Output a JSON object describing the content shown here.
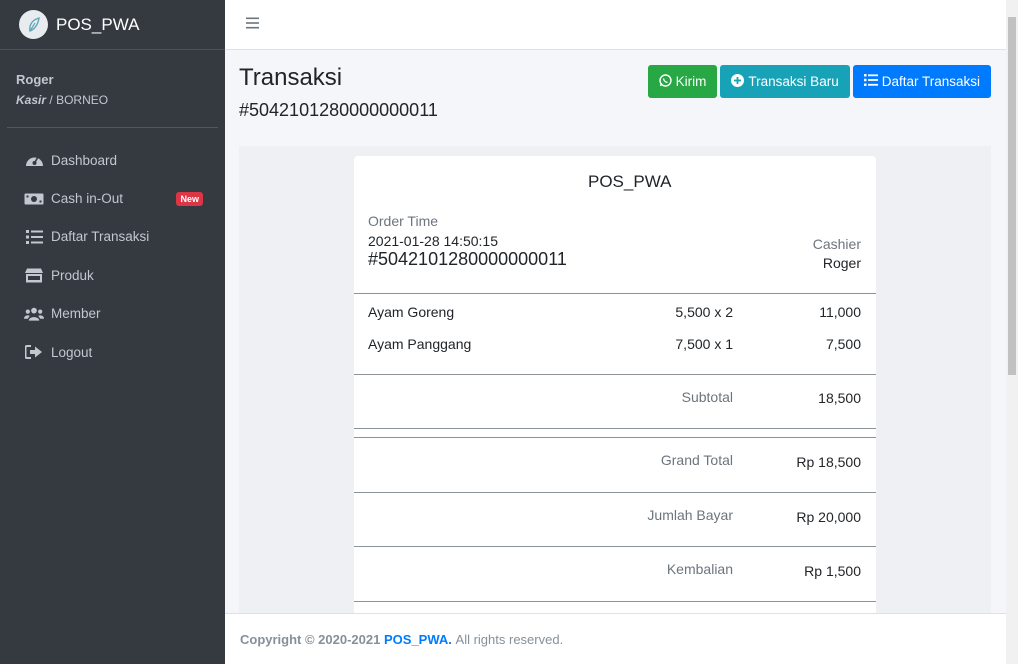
{
  "app": {
    "brand": "POS_PWA"
  },
  "user": {
    "name": "Roger",
    "role": "Kasir",
    "separator": "/",
    "store": "BORNEO"
  },
  "sidebar": {
    "items": [
      {
        "label": "Dashboard",
        "icon": "tachometer-icon"
      },
      {
        "label": "Cash in-Out",
        "icon": "money-icon",
        "badge": "New"
      },
      {
        "label": "Daftar Transaksi",
        "icon": "list-icon"
      },
      {
        "label": "Produk",
        "icon": "store-icon"
      },
      {
        "label": "Member",
        "icon": "users-icon"
      },
      {
        "label": "Logout",
        "icon": "sign-out-icon"
      }
    ]
  },
  "header": {
    "title": "Transaksi",
    "subtitle": "#5042101280000000011",
    "buttons": {
      "kirim": "Kirim",
      "new_transaction": "Transaksi Baru",
      "list": "Daftar Transaksi"
    }
  },
  "receipt": {
    "store": "POS_PWA",
    "order_time_label": "Order Time",
    "order_time": "2021-01-28 14:50:15",
    "order_number": "#5042101280000000011",
    "cashier_label": "Cashier",
    "cashier": "Roger",
    "items": [
      {
        "name": "Ayam Goreng",
        "qty": "5,500 x 2",
        "total": "11,000"
      },
      {
        "name": "Ayam Panggang",
        "qty": "7,500 x 1",
        "total": "7,500"
      }
    ],
    "subtotal_label": "Subtotal",
    "subtotal": "18,500",
    "grand_total_label": "Grand Total",
    "grand_total": "Rp 18,500",
    "paid_label": "Jumlah Bayar",
    "paid": "Rp 20,000",
    "change_label": "Kembalian",
    "change": "Rp 1,500"
  },
  "footer": {
    "copyright": "Copyright © 2020-2021",
    "brand": "POS_PWA.",
    "rights": "All rights reserved."
  },
  "colors": {
    "sidebar_bg": "#343a40",
    "success": "#28a745",
    "info": "#17a2b8",
    "primary": "#007bff",
    "danger": "#dc3545"
  }
}
